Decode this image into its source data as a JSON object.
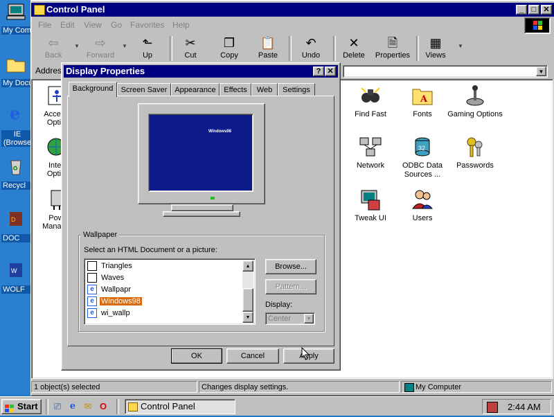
{
  "desktop": {
    "icons": [
      {
        "label": "My Com",
        "icon": "my-computer-icon"
      },
      {
        "label": "My Docu",
        "icon": "my-documents-icon"
      },
      {
        "label": "IE (Browse",
        "icon": "internet-explorer-icon"
      },
      {
        "label": "Recycl",
        "icon": "recycle-bin-icon"
      },
      {
        "label": "DOC",
        "icon": "doom-shortcut-icon"
      },
      {
        "label": "WOLF",
        "icon": "wolf-shortcut-icon"
      }
    ]
  },
  "window": {
    "title": "Control Panel",
    "menu": [
      "File",
      "Edit",
      "View",
      "Go",
      "Favorites",
      "Help"
    ],
    "toolbar": [
      {
        "label": "Back",
        "icon": "back-arrow-icon",
        "disabled": true
      },
      {
        "label": "Forward",
        "icon": "forward-arrow-icon",
        "disabled": true
      },
      {
        "label": "Up",
        "icon": "up-folder-icon",
        "disabled": false
      },
      {
        "label": "Cut",
        "icon": "scissors-icon",
        "disabled": false
      },
      {
        "label": "Copy",
        "icon": "copy-icon",
        "disabled": false
      },
      {
        "label": "Paste",
        "icon": "paste-icon",
        "disabled": false
      },
      {
        "label": "Undo",
        "icon": "undo-icon",
        "disabled": false
      },
      {
        "label": "Delete",
        "icon": "delete-x-icon",
        "disabled": false
      },
      {
        "label": "Properties",
        "icon": "properties-icon",
        "disabled": false
      },
      {
        "label": "Views",
        "icon": "views-icon",
        "disabled": false
      }
    ],
    "address_label": "Addres",
    "items_partial": [
      "Access",
      "Optio",
      "Inter",
      "Optio",
      "Pow",
      "Manage"
    ],
    "items": [
      {
        "label": "Find Fast",
        "icon": "binoculars-icon"
      },
      {
        "label": "Fonts",
        "icon": "fonts-folder-icon"
      },
      {
        "label": "Gaming Options",
        "icon": "joystick-icon"
      },
      {
        "label": "Network",
        "icon": "network-icon"
      },
      {
        "label": "ODBC Data Sources ...",
        "icon": "odbc-icon"
      },
      {
        "label": "Passwords",
        "icon": "keys-icon"
      },
      {
        "label": "Tweak UI",
        "icon": "tweak-ui-icon"
      },
      {
        "label": "Users",
        "icon": "users-icon"
      }
    ],
    "status": {
      "selected": "1 object(s) selected",
      "hint": "Changes display settings.",
      "zone": "My Computer"
    }
  },
  "dialog": {
    "title": "Display Properties",
    "title_buttons": [
      "?",
      "✕"
    ],
    "tabs": [
      "Background",
      "Screen Saver",
      "Appearance",
      "Effects",
      "Web",
      "Settings"
    ],
    "active_tab": "Background",
    "preview_logo": "Windows98",
    "wallpaper": {
      "legend": "Wallpaper",
      "prompt": "Select an HTML Document or a picture:",
      "items": [
        {
          "label": "Triangles",
          "icon": "bitmap-file-icon"
        },
        {
          "label": "Waves",
          "icon": "bitmap-file-icon"
        },
        {
          "label": "Wallpapr",
          "icon": "html-file-icon"
        },
        {
          "label": "Windows98",
          "icon": "html-file-icon"
        },
        {
          "label": "wi_wallp",
          "icon": "html-file-icon"
        }
      ],
      "selected": "Windows98",
      "browse": "Browse...",
      "pattern": "Pattern...",
      "display_label": "Display:",
      "display_value": "Center"
    },
    "buttons": {
      "ok": "OK",
      "cancel": "Cancel",
      "apply": "Apply"
    }
  },
  "taskbar": {
    "start": "Start",
    "quick_launch": [
      "show-desktop-icon",
      "ie-icon",
      "outlook-icon",
      "opera-icon"
    ],
    "tasks": [
      {
        "label": "Control Panel",
        "active": true
      }
    ],
    "clock": "2:44 AM"
  },
  "colors": {
    "title_bar": "#000080",
    "face": "#c0c0c0",
    "desktop": "#2a7fd0",
    "selection": "#d86a10",
    "preview_screen": "#0c1a8a"
  }
}
